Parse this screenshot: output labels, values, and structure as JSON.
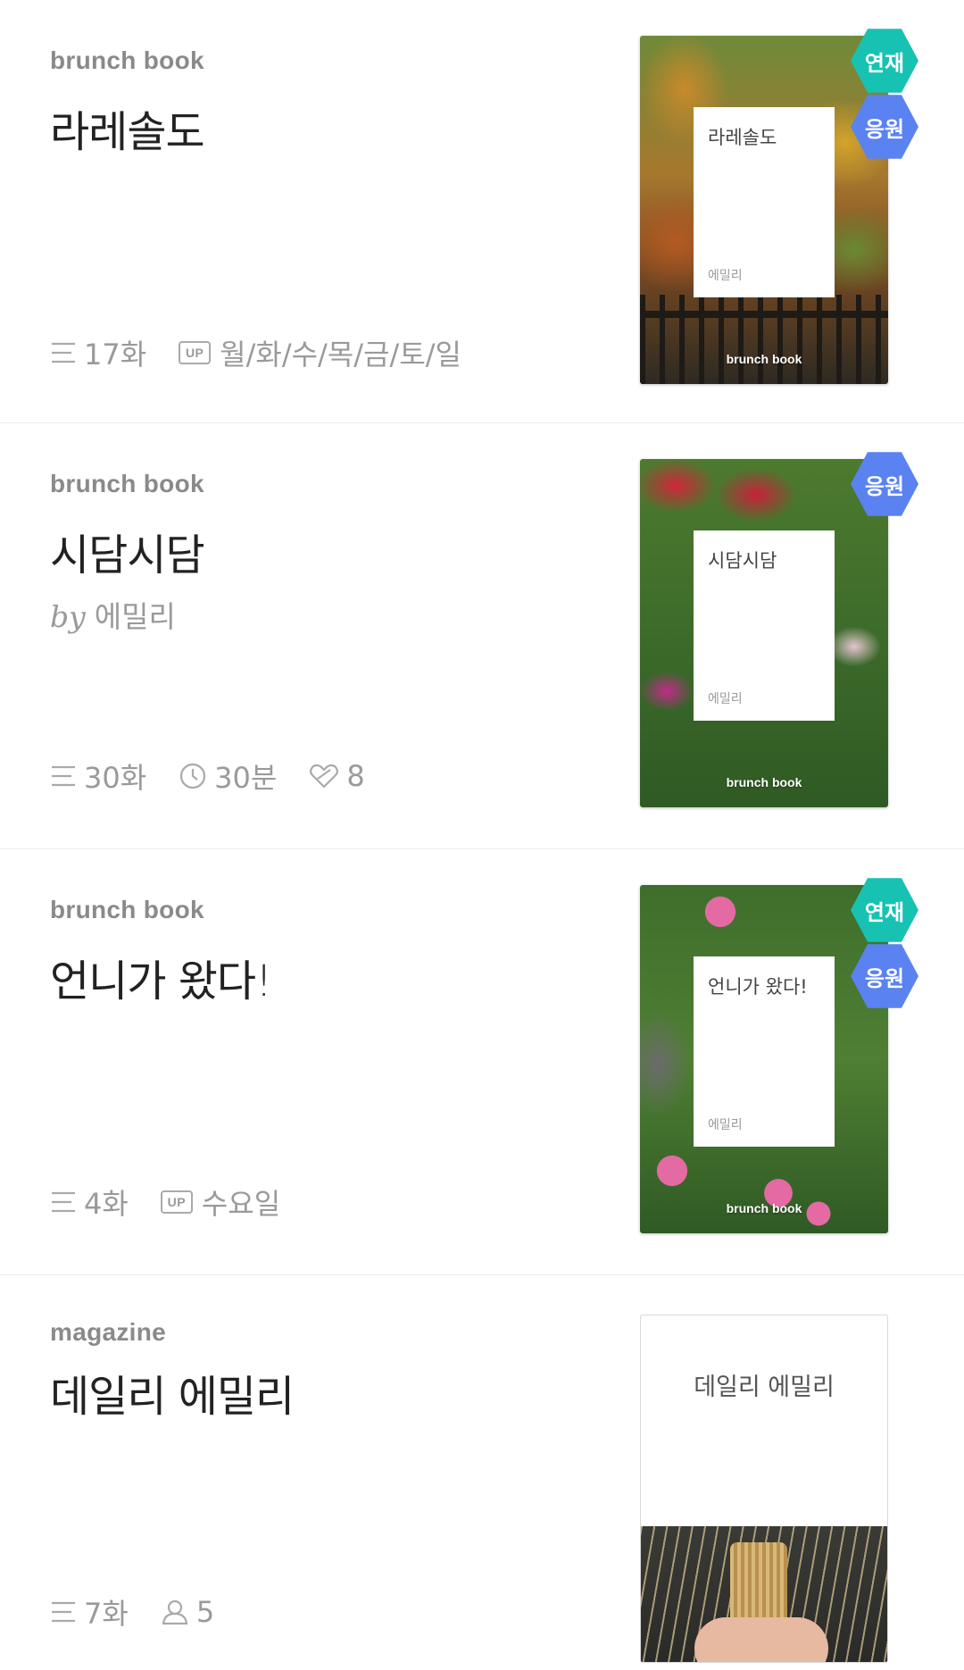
{
  "colors": {
    "serial_badge": "#18c2b3",
    "support_badge": "#5a82f0",
    "muted_text": "#9a9a9a",
    "title_text": "#222222"
  },
  "items": [
    {
      "kind": "brunch book",
      "title": "라레솔도",
      "episodes": "17화",
      "up_label": "UP",
      "schedule": "월/화/수/목/금/토/일",
      "cover": {
        "title": "라레솔도",
        "author": "에밀리",
        "brand": "brunch book",
        "badges": [
          "연재",
          "응원"
        ]
      }
    },
    {
      "kind": "brunch book",
      "title": "시담시담",
      "by_prefix": "by",
      "author": "에밀리",
      "episodes": "30화",
      "read_time": "30분",
      "likes": "8",
      "cover": {
        "title": "시담시담",
        "author": "에밀리",
        "brand": "brunch book",
        "badges": [
          "응원"
        ]
      }
    },
    {
      "kind": "brunch book",
      "title": "언니가 왔다!",
      "episodes": "4화",
      "up_label": "UP",
      "schedule": "수요일",
      "cover": {
        "title": "언니가 왔다!",
        "author": "에밀리",
        "brand": "brunch book",
        "badges": [
          "연재",
          "응원"
        ]
      }
    },
    {
      "kind": "magazine",
      "title": "데일리 에밀리",
      "episodes": "7화",
      "subscribers": "5",
      "cover": {
        "title": "데일리 에밀리"
      }
    }
  ]
}
